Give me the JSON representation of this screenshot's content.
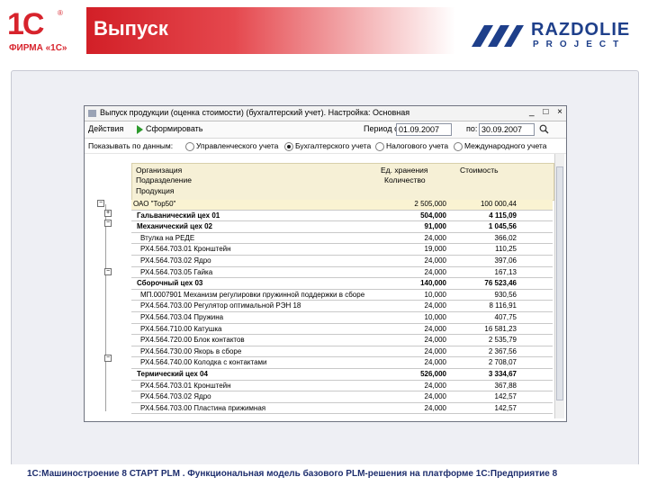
{
  "slide": {
    "title": "Выпуск",
    "footer": "1С:Машиностроение 8 СТАРТ PLM . Функциональная модель базового PLM-решения на платформе 1С:Предприятие 8"
  },
  "logo_1c": {
    "mark": "1С",
    "company": "ФИРМА «1С»",
    "reg": "®"
  },
  "logo_partner": {
    "name": "RAZDOLIE",
    "sub": "PROJECT"
  },
  "window": {
    "title": "Выпуск продукции (оценка стоимости) (бухгалтерский учет). Настройка: Основная",
    "controls": [
      "_",
      "□",
      "×"
    ],
    "toolbar": {
      "actions": "Действия",
      "generate": "Сформировать",
      "period_label": "Период с:",
      "date_from": "01.09.2007",
      "to_label": "по:",
      "date_to": "30.09.2007",
      "search_icon": "search-icon"
    },
    "options": {
      "label": "Показывать по данным:",
      "items": [
        {
          "label": "Управленческого учета",
          "selected": false
        },
        {
          "label": "Бухгалтерского учета",
          "selected": true
        },
        {
          "label": "Налогового учета",
          "selected": false
        },
        {
          "label": "Международного учета",
          "selected": false
        }
      ]
    },
    "report": {
      "headers": {
        "org": "Организация",
        "dept": "Подразделение",
        "product": "Продукция",
        "unit": "Ед. хранения",
        "qty": "Количество",
        "cost": "Стоимость"
      },
      "rows": [
        {
          "name": "ОАО \"Тор50\"",
          "qty": "2 505,000",
          "cost": "100 000,44",
          "kind": "total"
        },
        {
          "name": "Гальванический цех 01",
          "qty": "504,000",
          "cost": "4 115,09",
          "kind": "group"
        },
        {
          "name": "Механический цех 02",
          "qty": "91,000",
          "cost": "1 045,56",
          "kind": "group"
        },
        {
          "name": "Втулка на РЕДЕ",
          "qty": "24,000",
          "cost": "366,02",
          "kind": "item"
        },
        {
          "name": "РХ4.564.703.01 Кронштейн",
          "qty": "19,000",
          "cost": "110,25",
          "kind": "item"
        },
        {
          "name": "РХ4.564.703.02 Ядро",
          "qty": "24,000",
          "cost": "397,06",
          "kind": "item"
        },
        {
          "name": "РХ4.564.703.05 Гайка",
          "qty": "24,000",
          "cost": "167,13",
          "kind": "item"
        },
        {
          "name": "Сборочный цех 03",
          "qty": "140,000",
          "cost": "76 523,46",
          "kind": "group"
        },
        {
          "name": "МП.0007901 Механизм регулировки пружинной поддержки в сборе",
          "qty": "10,000",
          "cost": "930,56",
          "kind": "item"
        },
        {
          "name": "РХ4.564.703.00 Регулятор оптимальной РЭН 18",
          "qty": "24,000",
          "cost": "8 116,91",
          "kind": "item"
        },
        {
          "name": "РХ4.564.703.04 Пружина",
          "qty": "10,000",
          "cost": "407,75",
          "kind": "item"
        },
        {
          "name": "РХ4.564.710.00 Катушка",
          "qty": "24,000",
          "cost": "16 581,23",
          "kind": "item"
        },
        {
          "name": "РХ4.564.720.00 Блок контактов",
          "qty": "24,000",
          "cost": "2 535,79",
          "kind": "item"
        },
        {
          "name": "РХ4.564.730.00 Якорь в сборе",
          "qty": "24,000",
          "cost": "2 367,56",
          "kind": "item"
        },
        {
          "name": "РХ4.564.740.00 Колодка с контактами",
          "qty": "24,000",
          "cost": "2 708,07",
          "kind": "item"
        },
        {
          "name": "Термический цех 04",
          "qty": "526,000",
          "cost": "3 334,67",
          "kind": "group"
        },
        {
          "name": "РХ4.564.703.01 Кронштейн",
          "qty": "24,000",
          "cost": "367,88",
          "kind": "item"
        },
        {
          "name": "РХ4.564.703.02 Ядро",
          "qty": "24,000",
          "cost": "142,57",
          "kind": "item"
        },
        {
          "name": "РХ4.564.703.00 Пластина прижимная",
          "qty": "24,000",
          "cost": "142,57",
          "kind": "item"
        }
      ]
    }
  }
}
